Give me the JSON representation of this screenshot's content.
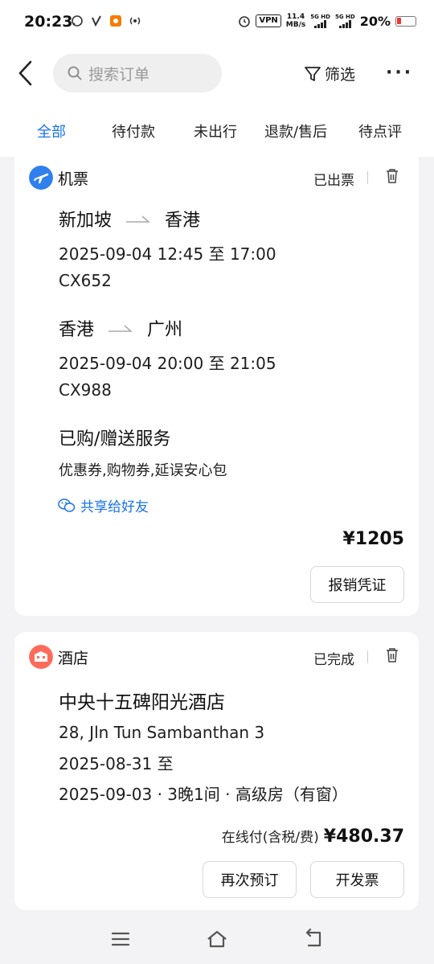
{
  "status_bar": {
    "time": "20:23",
    "vpn": "VPN",
    "speed_value": "11.4",
    "speed_unit": "MB/s",
    "sim1": "5G HD",
    "sim2": "5G HD",
    "battery": "20%",
    "battery_color": "#e53935"
  },
  "header": {
    "search_placeholder": "搜索订单",
    "filter_label": "筛选",
    "more_label": "···"
  },
  "tabs": [
    {
      "label": "全部",
      "active": true
    },
    {
      "label": "待付款",
      "active": false
    },
    {
      "label": "未出行",
      "active": false
    },
    {
      "label": "退款/售后",
      "active": false
    },
    {
      "label": "待点评",
      "active": false
    }
  ],
  "accent_color": "#1a73e8",
  "orders": [
    {
      "category": "机票",
      "category_icon": "airplane-icon",
      "status": "已出票",
      "segments": [
        {
          "from": "新加坡",
          "to": "香港",
          "time": "2025-09-04 12:45 至 17:00",
          "flight": "CX652"
        },
        {
          "from": "香港",
          "to": "广州",
          "time": "2025-09-04 20:00 至 21:05",
          "flight": "CX988"
        }
      ],
      "services_title": "已购/赠送服务",
      "services": "优惠券,购物券,延误安心包",
      "share_label": "共享给好友",
      "price": "¥1205",
      "button": "报销凭证"
    },
    {
      "category": "酒店",
      "category_icon": "hotel-icon",
      "status": "已完成",
      "hotel_name": "中央十五碑阳光酒店",
      "address": "28, Jln Tun Sambanthan 3",
      "checkin": "2025-08-31 至",
      "checkout_detail": "2025-09-03 · 3晚1间 · 高级房（有窗）",
      "price_label": "在线付(含税/费)",
      "price": "¥480.37",
      "buttons": [
        "再次预订",
        "开发票"
      ]
    }
  ]
}
